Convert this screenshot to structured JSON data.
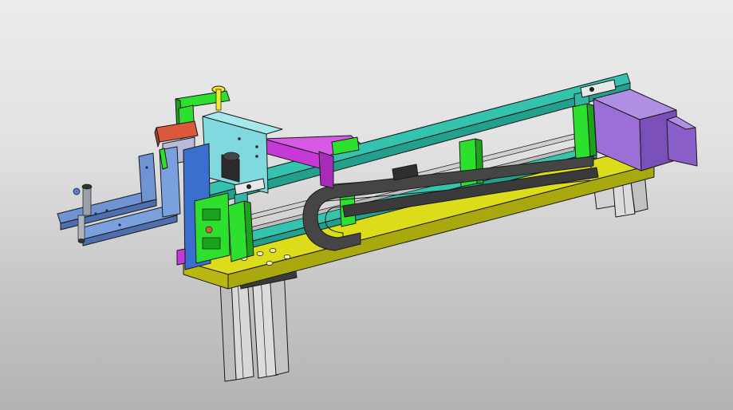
{
  "viewport": {
    "background_top": "#ececec",
    "background_bottom": "#b3b3b3"
  },
  "scene": {
    "subject": "cad-assembly-linear-module",
    "colors": {
      "frame_teal": "#33c3ae",
      "frame_teal_dark": "#23a08d",
      "base_plate_yellow": "#dcdc1a",
      "base_plate_yellow_dark": "#a9a80f",
      "bracket_green": "#2ee02e",
      "bracket_green_dark": "#1ba31b",
      "motor_purple": "#9b6fd6",
      "motor_purple_dark": "#7a4fb8",
      "magenta": "#c53ad6",
      "blue_arm": "#6f93d3",
      "blue_arm_dark": "#4d6fae",
      "cyan_block": "#7fd9df",
      "orange_red": "#d9593a",
      "drag_chain": "#454545",
      "rail_silver": "#cfcfcf",
      "leg_silver": "#d8d8d8",
      "yellow_pin": "#f5e82a"
    }
  }
}
